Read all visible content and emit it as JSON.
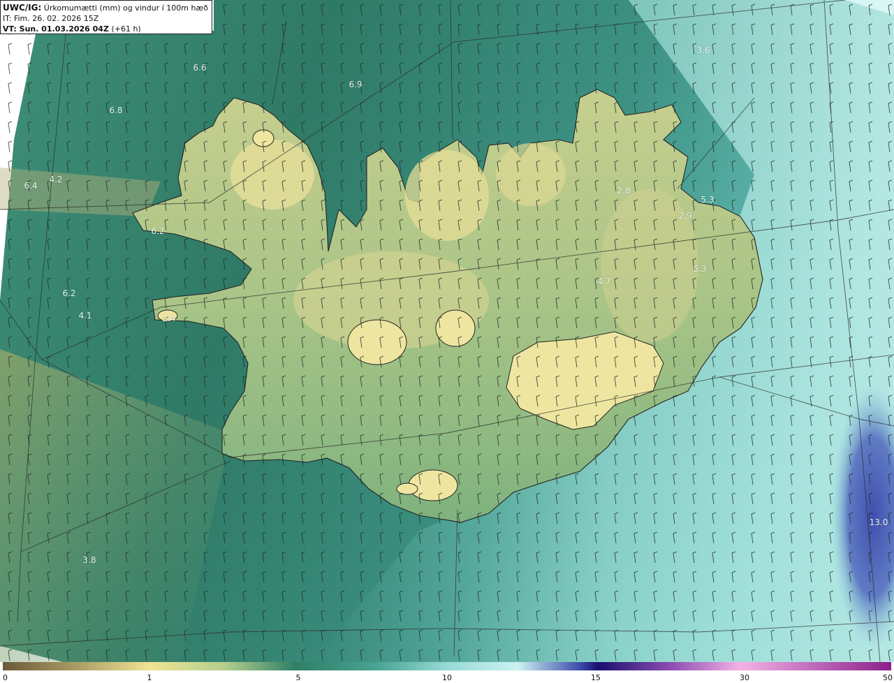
{
  "header": {
    "model": "UWC/IG:",
    "title": "Úrkomumætti (mm) og vindur í 100m hæð",
    "initial_time": "IT: Fim. 26. 02. 2026 15Z",
    "valid_label": "VT: Sun. 01.03.2026 04Z",
    "lead_time": "(+61 h)"
  },
  "map_labels": [
    {
      "text": "3.6"
    },
    {
      "text": "6.6"
    },
    {
      "text": "6.9"
    },
    {
      "text": "6.8"
    },
    {
      "text": "4.2"
    },
    {
      "text": "6.4"
    },
    {
      "text": "2.8"
    },
    {
      "text": "5.3"
    },
    {
      "text": "2.9"
    },
    {
      "text": "6.2"
    },
    {
      "text": "5.3"
    },
    {
      "text": "4.7"
    },
    {
      "text": "6.2"
    },
    {
      "text": "4.1"
    },
    {
      "text": "2.4"
    },
    {
      "text": "13.0"
    },
    {
      "text": "3.8"
    }
  ],
  "colorbar": {
    "ticks": [
      "0",
      "1",
      "5",
      "10",
      "15",
      "30",
      "50"
    ],
    "colors": [
      "#6b5a3a",
      "#c4b373",
      "#f0e394",
      "#c9d993",
      "#6aa97c",
      "#2f7f66",
      "#48a392",
      "#97dad6",
      "#ccf1f1",
      "#3c4bab",
      "#1a1070",
      "#b06dc2",
      "#f3b2e6",
      "#8a1f8a"
    ]
  },
  "colors": {
    "sea_dark": "#2f7a68",
    "sea_mid": "#4b9a86",
    "land_low": "#8cba83",
    "land_high": "#e9e19a",
    "sea_east": "#9fe2dc",
    "heavy_precip": "#4a61b6"
  }
}
